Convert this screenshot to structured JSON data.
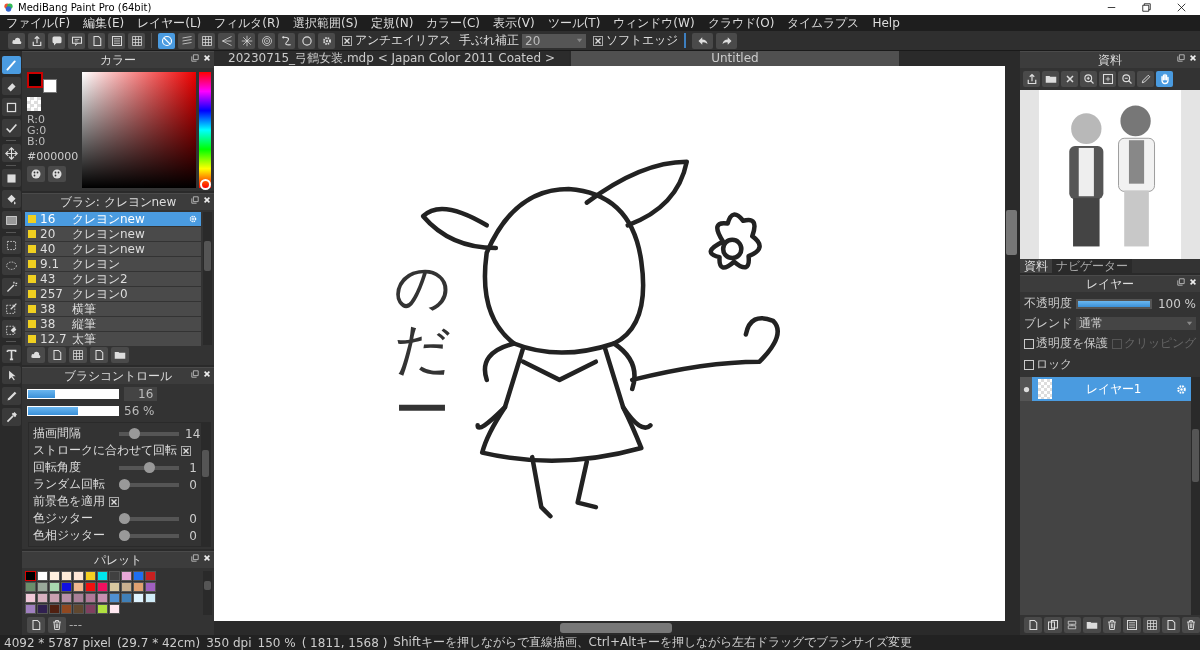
{
  "window": {
    "title": "MediBang Paint Pro (64bit)"
  },
  "menu": [
    "ファイル(F)",
    "編集(E)",
    "レイヤー(L)",
    "フィルタ(R)",
    "選択範囲(S)",
    "定規(N)",
    "カラー(C)",
    "表示(V)",
    "ツール(T)",
    "ウィンドウ(W)",
    "クラウド(O)",
    "タイムラプス",
    "Help"
  ],
  "toolbar": {
    "rulers": [
      {
        "selected": true
      },
      {
        "selected": false
      },
      {
        "selected": false
      },
      {
        "selected": false
      },
      {
        "selected": false
      },
      {
        "selected": false
      },
      {
        "selected": false
      },
      {
        "selected": false
      },
      {
        "selected": false
      }
    ],
    "antialias": {
      "label": "アンチエイリアス",
      "checked": true
    },
    "stabilizer": {
      "label": "手ぶれ補正",
      "value": "20"
    },
    "soft_edge": {
      "label": "ソフトエッジ",
      "checked": true
    }
  },
  "tools": [
    {
      "selected": true
    },
    {
      "selected": false
    },
    {
      "selected": false
    },
    {
      "selected": false
    },
    {
      "selected": false
    },
    {
      "selected": false
    },
    {
      "selected": false
    },
    {
      "selected": false
    },
    {
      "selected": false
    },
    {
      "selected": false
    },
    {
      "selected": false
    },
    {
      "selected": false
    },
    {
      "selected": false
    },
    {
      "selected": false
    },
    {
      "selected": false
    },
    {
      "selected": false
    },
    {
      "selected": false
    }
  ],
  "document_tabs": [
    {
      "label": "20230715_弓鶴女装.mdp < Japan Color 2011 Coated >",
      "selected": false
    },
    {
      "label": "Untitled",
      "selected": true
    }
  ],
  "color_panel": {
    "title": "カラー",
    "foreground": {
      "color": "#000000"
    },
    "background": {
      "color": "#ffffff"
    },
    "rgb": [
      "R:0",
      "G:0",
      "B:0"
    ],
    "hex": "#000000",
    "hue": {
      "level": 0
    }
  },
  "brush_panel": {
    "title": "ブラシ: クレヨンnew",
    "brushes": [
      {
        "size": "16",
        "name": "クレヨンnew",
        "selected": true
      },
      {
        "size": "20",
        "name": "クレヨンnew",
        "selected": false
      },
      {
        "size": "40",
        "name": "クレヨンnew",
        "selected": false
      },
      {
        "size": "9.1",
        "name": "クレヨン",
        "selected": false
      },
      {
        "size": "43",
        "name": "クレヨン2",
        "selected": false
      },
      {
        "size": "257",
        "name": "クレヨン0",
        "selected": false
      },
      {
        "size": "38",
        "name": "横筆",
        "selected": false
      },
      {
        "size": "38",
        "name": "縦筆",
        "selected": false
      },
      {
        "size": "12.7",
        "name": "太筆",
        "selected": false
      }
    ]
  },
  "brush_control": {
    "title": "ブラシコントロール",
    "size": {
      "level": 0.3,
      "reading": "16"
    },
    "opacity": {
      "level": 0.56,
      "reading": "56 %"
    },
    "settings": [
      {
        "kind": "slider",
        "label": "描画間隔",
        "level": 0.2,
        "reading": "14"
      },
      {
        "kind": "checkbox",
        "label": "ストロークに合わせて回転",
        "checked": true
      },
      {
        "kind": "slider",
        "label": "回転角度",
        "level": 0.5,
        "reading": "1"
      },
      {
        "kind": "slider",
        "label": "ランダム回転",
        "level": 0,
        "reading": "0"
      },
      {
        "kind": "checkbox",
        "label": "前景色を適用",
        "checked": true
      },
      {
        "kind": "slider",
        "label": "色ジッター",
        "level": 0,
        "reading": "0"
      },
      {
        "kind": "slider",
        "label": "色相ジッター",
        "level": 0,
        "reading": "0"
      }
    ]
  },
  "palette": {
    "title": "パレット",
    "footer": "---",
    "colors": [
      {
        "color": "#000000",
        "selected": true
      },
      {
        "color": "#ffffff",
        "selected": false
      },
      {
        "color": "#fff0e0",
        "selected": false
      },
      {
        "color": "#fdebd8",
        "selected": false
      },
      {
        "color": "#fde6d6",
        "selected": false
      },
      {
        "color": "#f5d020",
        "selected": false
      },
      {
        "color": "#00e5ee",
        "selected": false
      },
      {
        "color": "#404040",
        "selected": false
      },
      {
        "color": "#e8a8d8",
        "selected": false
      },
      {
        "color": "#1e6ef0",
        "selected": false
      },
      {
        "color": "#c82020",
        "selected": false
      },
      {
        "color": "#6b8e6b",
        "selected": false
      },
      {
        "color": "#9aa89a",
        "selected": false
      },
      {
        "color": "#a8d8b0",
        "selected": false
      },
      {
        "color": "#1010e0",
        "selected": false
      },
      {
        "color": "#f0b890",
        "selected": false
      },
      {
        "color": "#f01010",
        "selected": false
      },
      {
        "color": "#f01060",
        "selected": false
      },
      {
        "color": "#d8c8a0",
        "selected": false
      },
      {
        "color": "#c8b090",
        "selected": false
      },
      {
        "color": "#e0a070",
        "selected": false
      },
      {
        "color": "#a060c0",
        "selected": false
      },
      {
        "color": "#f0c8d8",
        "selected": false
      },
      {
        "color": "#d8b0c0",
        "selected": false
      },
      {
        "color": "#c8a0b0",
        "selected": false
      },
      {
        "color": "#b890a8",
        "selected": false
      },
      {
        "color": "#a88098",
        "selected": false
      },
      {
        "color": "#b07898",
        "selected": false
      },
      {
        "color": "#c890b0",
        "selected": false
      },
      {
        "color": "#5090d0",
        "selected": false
      },
      {
        "color": "#4080b8",
        "selected": false
      },
      {
        "color": "#e0f4ff",
        "selected": false
      },
      {
        "color": "#d0ecf8",
        "selected": false
      },
      {
        "color": "#a080c0",
        "selected": false
      },
      {
        "color": "#302050",
        "selected": false
      },
      {
        "color": "#502010",
        "selected": false
      },
      {
        "color": "#904820",
        "selected": false
      },
      {
        "color": "#604830",
        "selected": false
      },
      {
        "color": "#804060",
        "selected": false
      },
      {
        "color": "#b0e040",
        "selected": false
      },
      {
        "color": "#ffe8f0",
        "selected": false
      }
    ]
  },
  "canvas": {
    "handwriting": "のだー"
  },
  "reference_panel": {
    "title": "資料",
    "tools": [
      {
        "selected": false
      },
      {
        "selected": false
      },
      {
        "selected": false
      },
      {
        "selected": false
      },
      {
        "selected": false
      },
      {
        "selected": false
      },
      {
        "selected": false
      },
      {
        "selected": true
      }
    ],
    "tabs": [
      {
        "label": "資料",
        "selected": true
      },
      {
        "label": "ナビゲーター",
        "selected": false
      }
    ]
  },
  "layers_panel": {
    "title": "レイヤー",
    "opacity": {
      "label": "不透明度",
      "level": 1,
      "reading": "100 %"
    },
    "blend": {
      "label": "ブレンド",
      "value": "通常"
    },
    "options": [
      {
        "label": "透明度を保護",
        "checked": false,
        "disabled": false
      },
      {
        "label": "クリッピング",
        "checked": false,
        "disabled": true
      },
      {
        "label": "ロック",
        "checked": false,
        "disabled": false
      }
    ],
    "layers": [
      {
        "name": "レイヤー1",
        "selected": true,
        "visible": true
      }
    ]
  },
  "status_bar": [
    "4092 * 5787 pixel",
    "(29.7 * 42cm)",
    "350 dpi",
    "150 %",
    "( 1811, 1568 )",
    "Shiftキーを押しながらで直線描画、Ctrl+Altキーを押しながら左右ドラッグでブラシサイズ変更"
  ]
}
